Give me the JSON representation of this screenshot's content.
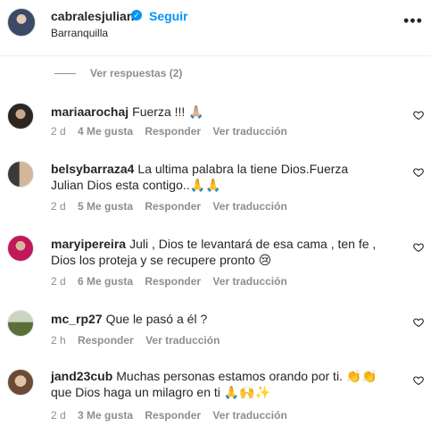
{
  "header": {
    "username": "cabralesjulian",
    "verified_mark": "✓",
    "separator": "•",
    "follow_label": "Seguir",
    "location": "Barranquilla",
    "more_label": "•••"
  },
  "replies": {
    "label": "Ver respuestas (2)"
  },
  "comments": [
    {
      "user": "mariaarochaj",
      "text": "Fuerza !!! 🙏🏼",
      "time": "2 d",
      "likes": "4 Me gusta",
      "reply": "Responder",
      "translate": "Ver traducción"
    },
    {
      "user": "belsybarraza4",
      "text": "La ultima palabra la tiene Dios.Fuerza Julian Dios esta contigo..🙏🙏",
      "time": "2 d",
      "likes": "5 Me gusta",
      "reply": "Responder",
      "translate": "Ver traducción"
    },
    {
      "user": "maryipereira",
      "text": "Juli , Dios te levantará de esa cama , ten fe , Dios los proteja y se recupere pronto 😢",
      "time": "2 d",
      "likes": "6 Me gusta",
      "reply": "Responder",
      "translate": "Ver traducción"
    },
    {
      "user": "mc_rp27",
      "text": "Que le pasó a él ?",
      "time": "2 h",
      "reply": "Responder",
      "translate": "Ver traducción"
    },
    {
      "user": "jand23cub",
      "text": "Muchas personas estamos orando por ti. 👏👏 que Dios haga un milagro en ti 🙏🙌✨",
      "time": "2 d",
      "likes": "3 Me gusta",
      "reply": "Responder",
      "translate": "Ver traducción"
    }
  ]
}
